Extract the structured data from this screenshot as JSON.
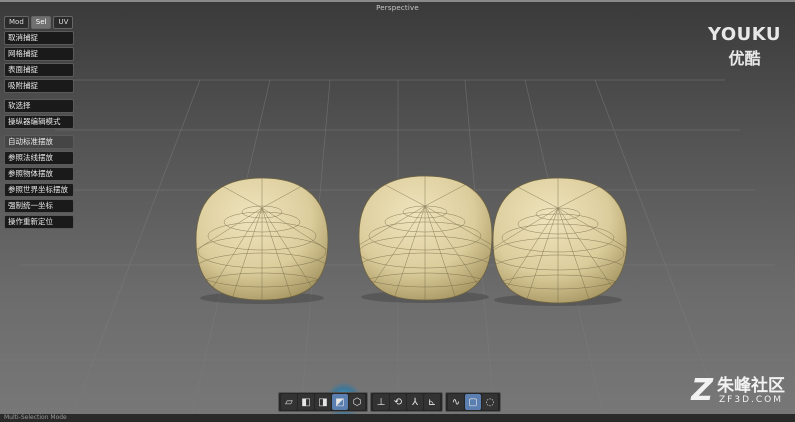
{
  "viewport": {
    "title": "Perspective"
  },
  "mode_tabs": [
    {
      "label": "Mod",
      "active": false
    },
    {
      "label": "Sel",
      "active": true
    },
    {
      "label": "UV",
      "active": false
    }
  ],
  "snap_buttons": [
    "取消捕捉",
    "网格捕捉",
    "表面捕捉",
    "吸附捕捉"
  ],
  "selection_buttons": [
    "软选择",
    "操纵器编辑模式"
  ],
  "placement_buttons": [
    "自动标准摆放",
    "参照法线摆放",
    "参照物体摆放",
    "参照世界坐标摆放",
    "强制统一坐标",
    "操作重新定位"
  ],
  "toolbar": {
    "view_icons": [
      "cube-wire-icon",
      "cube-front-icon",
      "cube-side-icon",
      "cube-persp-icon",
      "cube-solid-icon"
    ],
    "axis_icons": [
      "axis-up-icon",
      "axis-rotate-icon",
      "axis-tripod-icon",
      "axis-local-icon"
    ],
    "select_icons": [
      "lasso-select-icon",
      "rect-select-icon",
      "paint-select-icon"
    ]
  },
  "watermarks": {
    "youku_en": "YOUKU",
    "youku_cn": "优酷",
    "zf_logo": "Z",
    "zf_cn": "朱峰社区",
    "zf_en": "ZF3D.COM"
  },
  "status_text": "Multi-Selection Mode",
  "colors": {
    "mesh_fill": "#e0d3a6",
    "mesh_shadow": "#8a7c52",
    "wire": "#5a5238",
    "panel_bg": "#1a1a1a",
    "active_tab": "#707070"
  }
}
